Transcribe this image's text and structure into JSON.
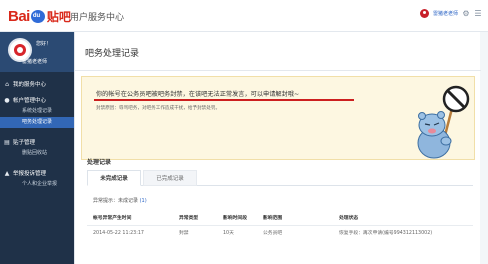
{
  "header": {
    "logo_text_1": "Bai",
    "logo_paw_text": "du",
    "logo_text_2": "贴吧",
    "site_name": "用户服务中心",
    "user_name": "雷猪老老师"
  },
  "sidebar": {
    "greeting": "您好！",
    "username": "雷猪老老师",
    "sections": [
      {
        "label": "我的服务中心",
        "items": []
      },
      {
        "label": "帐户管理中心",
        "items": [
          {
            "label": "系统处理记录",
            "active": false
          },
          {
            "label": "吧务处理记录",
            "active": true
          }
        ]
      },
      {
        "label": "贴子管理",
        "items": [
          {
            "label": "删贴回收站",
            "active": false
          }
        ]
      },
      {
        "label": "举报投诉管理",
        "items": [
          {
            "label": "个人和企业举报",
            "active": false
          }
        ]
      }
    ]
  },
  "main": {
    "title": "吧务处理记录",
    "notice": {
      "message": "你的帐号在公务员吧被吧务封禁，在该吧无法正常发言，可以申请解封哦~",
      "reason": "封禁原因：辱骂吧务，对吧务工作造成干扰，给予封禁处罚。"
    },
    "records_title": "处理记录",
    "tabs": [
      {
        "label": "未完成记录",
        "active": true
      },
      {
        "label": "已完成记录",
        "active": false
      }
    ],
    "hint_prefix": "异常提示：未成记录",
    "hint_count": "(1)",
    "table": {
      "headers": [
        "帐号异常产生时间",
        "异常类型",
        "影响时间段",
        "影响范围",
        "处理状态"
      ],
      "rows": [
        [
          "2014-05-22 11:23:17",
          "封禁",
          "10天",
          "公务员吧",
          "恢复手段：再次申请(编号994312113002)"
        ]
      ]
    }
  }
}
